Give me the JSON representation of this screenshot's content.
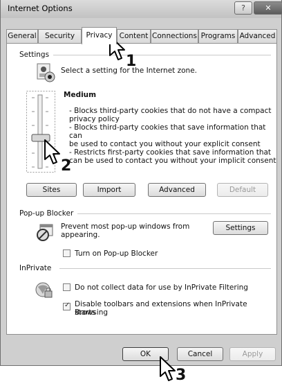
{
  "window": {
    "title": "Internet Options",
    "help_label": "?",
    "close_label": "✕"
  },
  "tabs": [
    "General",
    "Security",
    "Privacy",
    "Content",
    "Connections",
    "Programs",
    "Advanced"
  ],
  "privacy": {
    "settings_group": "Settings",
    "prompt": "Select a setting for the Internet zone.",
    "level": "Medium",
    "description_lines": [
      "- Blocks third-party cookies that do not have a compact",
      "privacy policy",
      "- Blocks third-party cookies that save information that can",
      "be used to contact you without your explicit consent",
      "- Restricts first-party cookies that save information that",
      "can be used to contact you without your implicit consent"
    ],
    "buttons": {
      "sites": "Sites",
      "import": "Import",
      "advanced": "Advanced",
      "default": "Default"
    },
    "popup_group": "Pop-up Blocker",
    "popup_text": [
      "Prevent most pop-up windows from",
      "appearing."
    ],
    "popup_settings": "Settings",
    "popup_checkbox": "Turn on Pop-up Blocker",
    "inprivate_group": "InPrivate",
    "inprivate_check1": "Do not collect data for use by InPrivate Filtering",
    "inprivate_check2": [
      "Disable toolbars and extensions when InPrivate Browsing",
      "starts"
    ]
  },
  "footer": {
    "ok": "OK",
    "cancel": "Cancel",
    "apply": "Apply"
  },
  "step_markers": [
    "1",
    "2",
    "3"
  ]
}
